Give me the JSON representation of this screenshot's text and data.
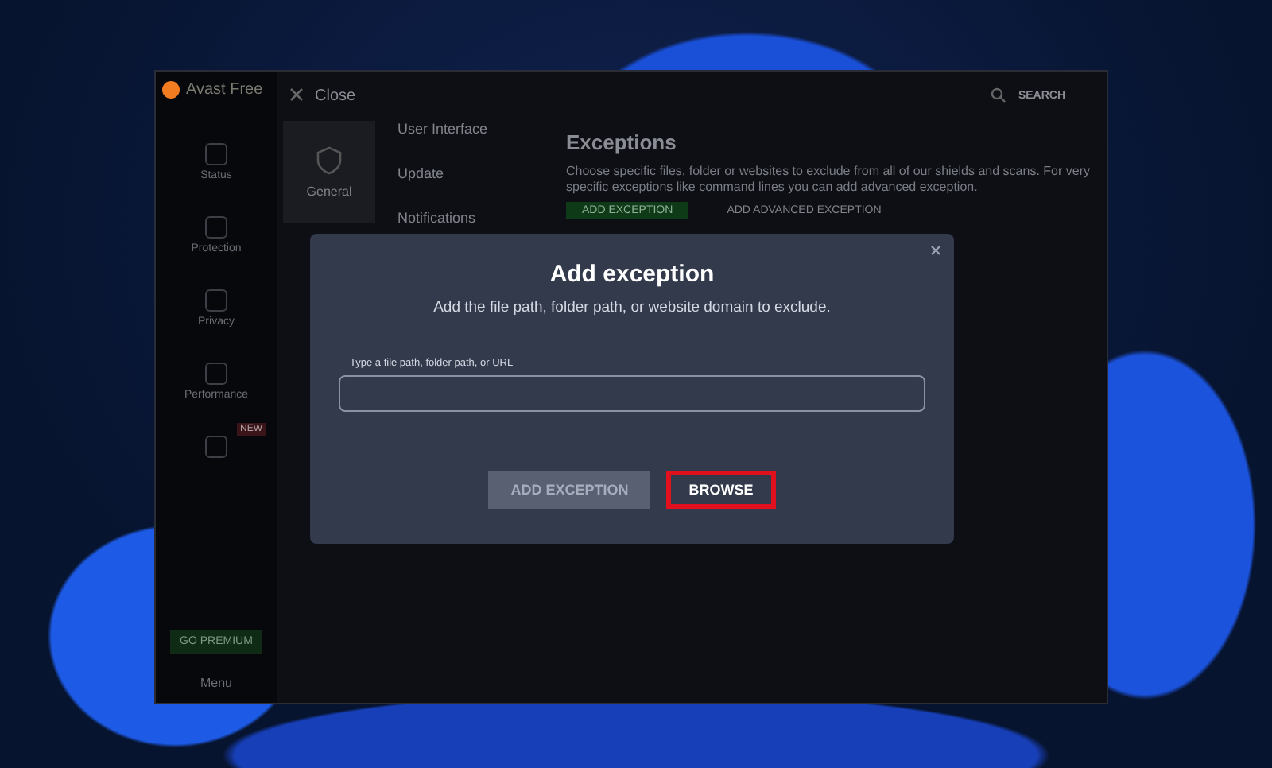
{
  "app": {
    "title": "Avast Free",
    "close_label": "Close",
    "search_label": "SEARCH",
    "sidebar": [
      {
        "label": "Status"
      },
      {
        "label": "Protection"
      },
      {
        "label": "Privacy"
      },
      {
        "label": "Performance"
      },
      {
        "badge": "NEW"
      }
    ],
    "premium_button": "GO PREMIUM",
    "menu_label": "Menu",
    "categories": [
      {
        "label": "General",
        "selected": true
      }
    ],
    "subnav": [
      "User Interface",
      "Update",
      "Notifications"
    ],
    "section": {
      "title": "Exceptions",
      "description": "Choose specific files, folder or websites to exclude from all of our shields and scans. For very specific exceptions like command lines you can add advanced exception.",
      "buttons": [
        {
          "label": "ADD EXCEPTION",
          "kind": "primary"
        },
        {
          "label": "ADD ADVANCED EXCEPTION",
          "kind": "link"
        }
      ]
    }
  },
  "dialog": {
    "title": "Add exception",
    "subtitle": "Add the file path, folder path, or website domain to exclude.",
    "field_label": "Type a file path, folder path, or URL",
    "buttons": [
      {
        "label": "ADD EXCEPTION",
        "disabled": true,
        "highlighted": false
      },
      {
        "label": "BROWSE",
        "disabled": false,
        "highlighted": true
      }
    ]
  }
}
